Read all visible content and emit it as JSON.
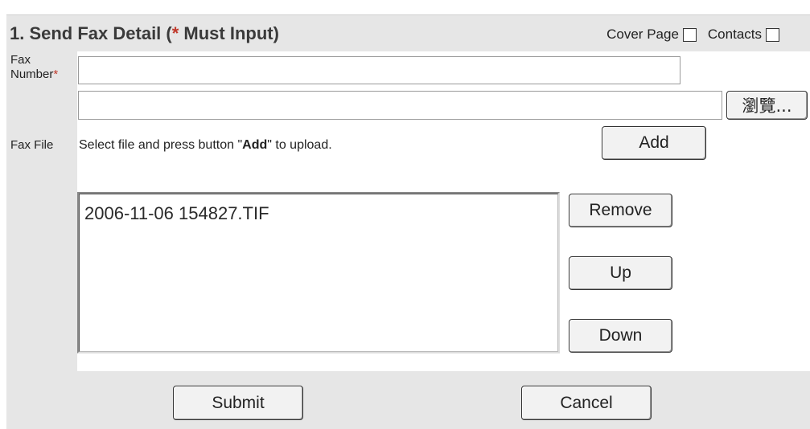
{
  "section": {
    "title_main": "1. Send Fax Detail (",
    "title_asterisk": "*",
    "title_tail": " Must Input)"
  },
  "options": {
    "cover_page_label": "Cover Page",
    "contacts_label": "Contacts"
  },
  "fax_number": {
    "label_line1": "Fax",
    "label_line2": "Number",
    "required_mark": "*",
    "value": ""
  },
  "fax_file": {
    "label": "Fax File",
    "path_value": "",
    "browse_label": "瀏覽...",
    "hint_prefix": "Select file and press button \"",
    "hint_bold": "Add",
    "hint_suffix": "\" to upload.",
    "add_label": "Add",
    "files": [
      "2006-11-06 154827.TIF"
    ],
    "remove_label": "Remove",
    "up_label": "Up",
    "down_label": "Down"
  },
  "footer": {
    "submit_label": "Submit",
    "cancel_label": "Cancel"
  }
}
